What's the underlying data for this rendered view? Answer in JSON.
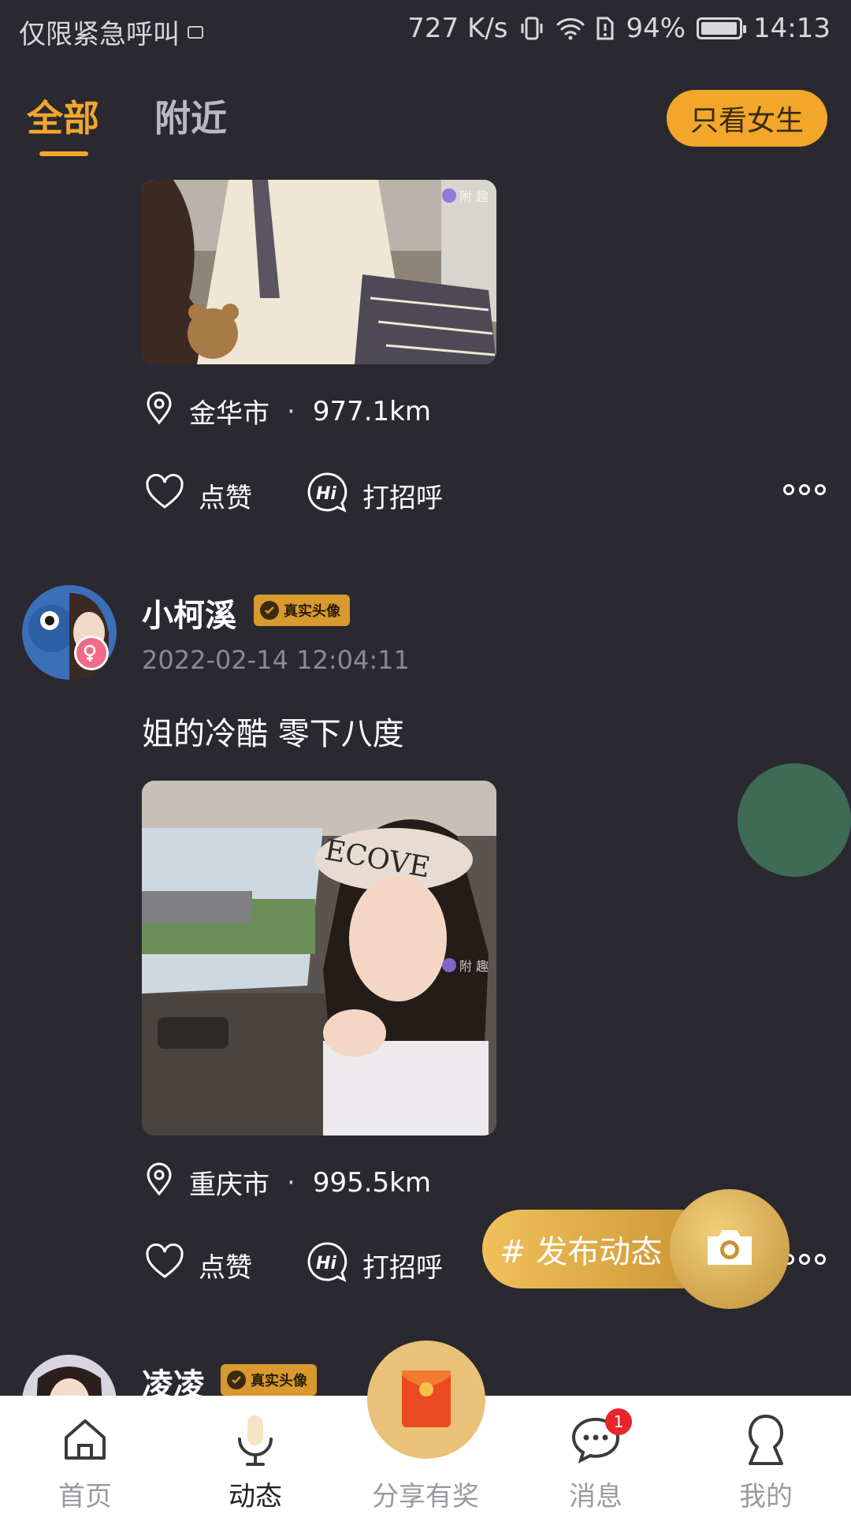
{
  "status_bar": {
    "carrier_text": "仅限紧急呼叫",
    "network_speed": "727 K/s",
    "battery_percent": "94%",
    "time": "14:13"
  },
  "top_tabs": {
    "all": "全部",
    "nearby": "附近",
    "active": "all",
    "female_only_button": "只看女生"
  },
  "accent_color": "#f2a72a",
  "watermark_text": "附 趣",
  "posts": [
    {
      "location": "金华市",
      "distance": "977.1km",
      "like_label": "点赞",
      "greet_label": "打招呼"
    },
    {
      "username": "小柯溪",
      "badge": "真实头像",
      "timestamp": "2022-02-14 12:04:11",
      "text": "姐的冷酷 零下八度",
      "location": "重庆市",
      "distance": "995.5km",
      "like_label": "点赞",
      "greet_label": "打招呼"
    },
    {
      "username": "凌凌",
      "badge": "真实头像"
    }
  ],
  "publish_button": "# 发布动态",
  "bottom_nav": [
    {
      "label": "首页",
      "icon": "home-icon"
    },
    {
      "label": "动态",
      "icon": "mic-icon",
      "active": true
    },
    {
      "label": "分享有奖",
      "icon": "red-envelope-icon"
    },
    {
      "label": "消息",
      "icon": "chat-icon",
      "badge": "1"
    },
    {
      "label": "我的",
      "icon": "profile-icon"
    }
  ]
}
